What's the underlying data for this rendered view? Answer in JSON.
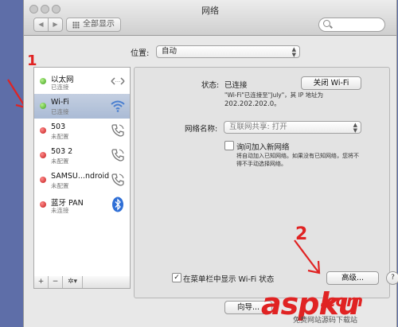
{
  "window": {
    "title": "网络",
    "show_all_label": "全部显示"
  },
  "location": {
    "label": "位置:",
    "value": "自动"
  },
  "services": [
    {
      "name": "以太网",
      "status": "已连接",
      "status_color": "green",
      "icon": "ethernet-icon"
    },
    {
      "name": "Wi-Fi",
      "status": "已连接",
      "status_color": "green",
      "icon": "wifi-icon",
      "selected": true
    },
    {
      "name": "503",
      "status": "未配置",
      "status_color": "red",
      "icon": "phone-icon"
    },
    {
      "name": "503 2",
      "status": "未配置",
      "status_color": "red",
      "icon": "phone-icon"
    },
    {
      "name": "SAMSU...ndroid",
      "status": "未配置",
      "status_color": "red",
      "icon": "phone-icon"
    },
    {
      "name": "蓝牙 PAN",
      "status": "未连接",
      "status_color": "red",
      "icon": "bluetooth-icon"
    }
  ],
  "sidebar_controls": {
    "add": "+",
    "remove": "−",
    "action": "✲▾"
  },
  "detail": {
    "status_label": "状态:",
    "status_value": "已连接",
    "turn_off_button": "关闭 Wi-Fi",
    "status_desc_line1": "\"Wi-Fi\"已连接至\"July\"，其 IP 地址为",
    "status_desc_line2": "202.202.202.0。",
    "network_name_label": "网络名称:",
    "network_name_value": "互联网共享: 打开",
    "ask_join_label": "询问加入新网络",
    "ask_join_desc_line1": "将自动加入已知网络。如果没有已知网络，您将不",
    "ask_join_desc_line2": "得不手动选择网络。",
    "show_in_menubar_label": "在菜单栏中显示 Wi-Fi 状态",
    "advanced_button": "高级...",
    "help_button": "?"
  },
  "footer": {
    "assist_button": "向导..."
  },
  "annotations": {
    "marker_1": "1",
    "marker_2": "2"
  },
  "watermark": {
    "main": "aspku",
    "suffix": ".com",
    "sub": "免费网站源码下载站"
  },
  "colors": {
    "desktop": "#5e6ea8",
    "accent_red": "#e02323",
    "selection": "#aabbd5"
  }
}
